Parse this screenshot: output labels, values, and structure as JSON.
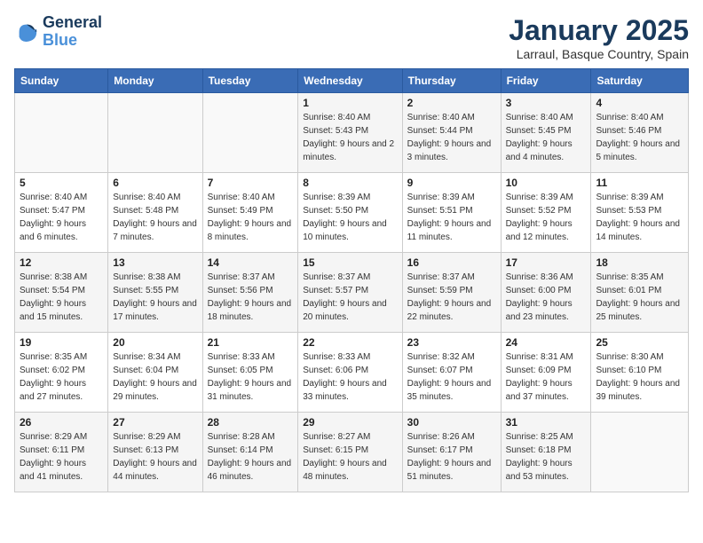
{
  "logo": {
    "line1": "General",
    "line2": "Blue"
  },
  "title": "January 2025",
  "subtitle": "Larraul, Basque Country, Spain",
  "days_header": [
    "Sunday",
    "Monday",
    "Tuesday",
    "Wednesday",
    "Thursday",
    "Friday",
    "Saturday"
  ],
  "weeks": [
    [
      {
        "num": "",
        "sunrise": "",
        "sunset": "",
        "daylight": ""
      },
      {
        "num": "",
        "sunrise": "",
        "sunset": "",
        "daylight": ""
      },
      {
        "num": "",
        "sunrise": "",
        "sunset": "",
        "daylight": ""
      },
      {
        "num": "1",
        "sunrise": "Sunrise: 8:40 AM",
        "sunset": "Sunset: 5:43 PM",
        "daylight": "Daylight: 9 hours and 2 minutes."
      },
      {
        "num": "2",
        "sunrise": "Sunrise: 8:40 AM",
        "sunset": "Sunset: 5:44 PM",
        "daylight": "Daylight: 9 hours and 3 minutes."
      },
      {
        "num": "3",
        "sunrise": "Sunrise: 8:40 AM",
        "sunset": "Sunset: 5:45 PM",
        "daylight": "Daylight: 9 hours and 4 minutes."
      },
      {
        "num": "4",
        "sunrise": "Sunrise: 8:40 AM",
        "sunset": "Sunset: 5:46 PM",
        "daylight": "Daylight: 9 hours and 5 minutes."
      }
    ],
    [
      {
        "num": "5",
        "sunrise": "Sunrise: 8:40 AM",
        "sunset": "Sunset: 5:47 PM",
        "daylight": "Daylight: 9 hours and 6 minutes."
      },
      {
        "num": "6",
        "sunrise": "Sunrise: 8:40 AM",
        "sunset": "Sunset: 5:48 PM",
        "daylight": "Daylight: 9 hours and 7 minutes."
      },
      {
        "num": "7",
        "sunrise": "Sunrise: 8:40 AM",
        "sunset": "Sunset: 5:49 PM",
        "daylight": "Daylight: 9 hours and 8 minutes."
      },
      {
        "num": "8",
        "sunrise": "Sunrise: 8:39 AM",
        "sunset": "Sunset: 5:50 PM",
        "daylight": "Daylight: 9 hours and 10 minutes."
      },
      {
        "num": "9",
        "sunrise": "Sunrise: 8:39 AM",
        "sunset": "Sunset: 5:51 PM",
        "daylight": "Daylight: 9 hours and 11 minutes."
      },
      {
        "num": "10",
        "sunrise": "Sunrise: 8:39 AM",
        "sunset": "Sunset: 5:52 PM",
        "daylight": "Daylight: 9 hours and 12 minutes."
      },
      {
        "num": "11",
        "sunrise": "Sunrise: 8:39 AM",
        "sunset": "Sunset: 5:53 PM",
        "daylight": "Daylight: 9 hours and 14 minutes."
      }
    ],
    [
      {
        "num": "12",
        "sunrise": "Sunrise: 8:38 AM",
        "sunset": "Sunset: 5:54 PM",
        "daylight": "Daylight: 9 hours and 15 minutes."
      },
      {
        "num": "13",
        "sunrise": "Sunrise: 8:38 AM",
        "sunset": "Sunset: 5:55 PM",
        "daylight": "Daylight: 9 hours and 17 minutes."
      },
      {
        "num": "14",
        "sunrise": "Sunrise: 8:37 AM",
        "sunset": "Sunset: 5:56 PM",
        "daylight": "Daylight: 9 hours and 18 minutes."
      },
      {
        "num": "15",
        "sunrise": "Sunrise: 8:37 AM",
        "sunset": "Sunset: 5:57 PM",
        "daylight": "Daylight: 9 hours and 20 minutes."
      },
      {
        "num": "16",
        "sunrise": "Sunrise: 8:37 AM",
        "sunset": "Sunset: 5:59 PM",
        "daylight": "Daylight: 9 hours and 22 minutes."
      },
      {
        "num": "17",
        "sunrise": "Sunrise: 8:36 AM",
        "sunset": "Sunset: 6:00 PM",
        "daylight": "Daylight: 9 hours and 23 minutes."
      },
      {
        "num": "18",
        "sunrise": "Sunrise: 8:35 AM",
        "sunset": "Sunset: 6:01 PM",
        "daylight": "Daylight: 9 hours and 25 minutes."
      }
    ],
    [
      {
        "num": "19",
        "sunrise": "Sunrise: 8:35 AM",
        "sunset": "Sunset: 6:02 PM",
        "daylight": "Daylight: 9 hours and 27 minutes."
      },
      {
        "num": "20",
        "sunrise": "Sunrise: 8:34 AM",
        "sunset": "Sunset: 6:04 PM",
        "daylight": "Daylight: 9 hours and 29 minutes."
      },
      {
        "num": "21",
        "sunrise": "Sunrise: 8:33 AM",
        "sunset": "Sunset: 6:05 PM",
        "daylight": "Daylight: 9 hours and 31 minutes."
      },
      {
        "num": "22",
        "sunrise": "Sunrise: 8:33 AM",
        "sunset": "Sunset: 6:06 PM",
        "daylight": "Daylight: 9 hours and 33 minutes."
      },
      {
        "num": "23",
        "sunrise": "Sunrise: 8:32 AM",
        "sunset": "Sunset: 6:07 PM",
        "daylight": "Daylight: 9 hours and 35 minutes."
      },
      {
        "num": "24",
        "sunrise": "Sunrise: 8:31 AM",
        "sunset": "Sunset: 6:09 PM",
        "daylight": "Daylight: 9 hours and 37 minutes."
      },
      {
        "num": "25",
        "sunrise": "Sunrise: 8:30 AM",
        "sunset": "Sunset: 6:10 PM",
        "daylight": "Daylight: 9 hours and 39 minutes."
      }
    ],
    [
      {
        "num": "26",
        "sunrise": "Sunrise: 8:29 AM",
        "sunset": "Sunset: 6:11 PM",
        "daylight": "Daylight: 9 hours and 41 minutes."
      },
      {
        "num": "27",
        "sunrise": "Sunrise: 8:29 AM",
        "sunset": "Sunset: 6:13 PM",
        "daylight": "Daylight: 9 hours and 44 minutes."
      },
      {
        "num": "28",
        "sunrise": "Sunrise: 8:28 AM",
        "sunset": "Sunset: 6:14 PM",
        "daylight": "Daylight: 9 hours and 46 minutes."
      },
      {
        "num": "29",
        "sunrise": "Sunrise: 8:27 AM",
        "sunset": "Sunset: 6:15 PM",
        "daylight": "Daylight: 9 hours and 48 minutes."
      },
      {
        "num": "30",
        "sunrise": "Sunrise: 8:26 AM",
        "sunset": "Sunset: 6:17 PM",
        "daylight": "Daylight: 9 hours and 51 minutes."
      },
      {
        "num": "31",
        "sunrise": "Sunrise: 8:25 AM",
        "sunset": "Sunset: 6:18 PM",
        "daylight": "Daylight: 9 hours and 53 minutes."
      },
      {
        "num": "",
        "sunrise": "",
        "sunset": "",
        "daylight": ""
      }
    ]
  ]
}
